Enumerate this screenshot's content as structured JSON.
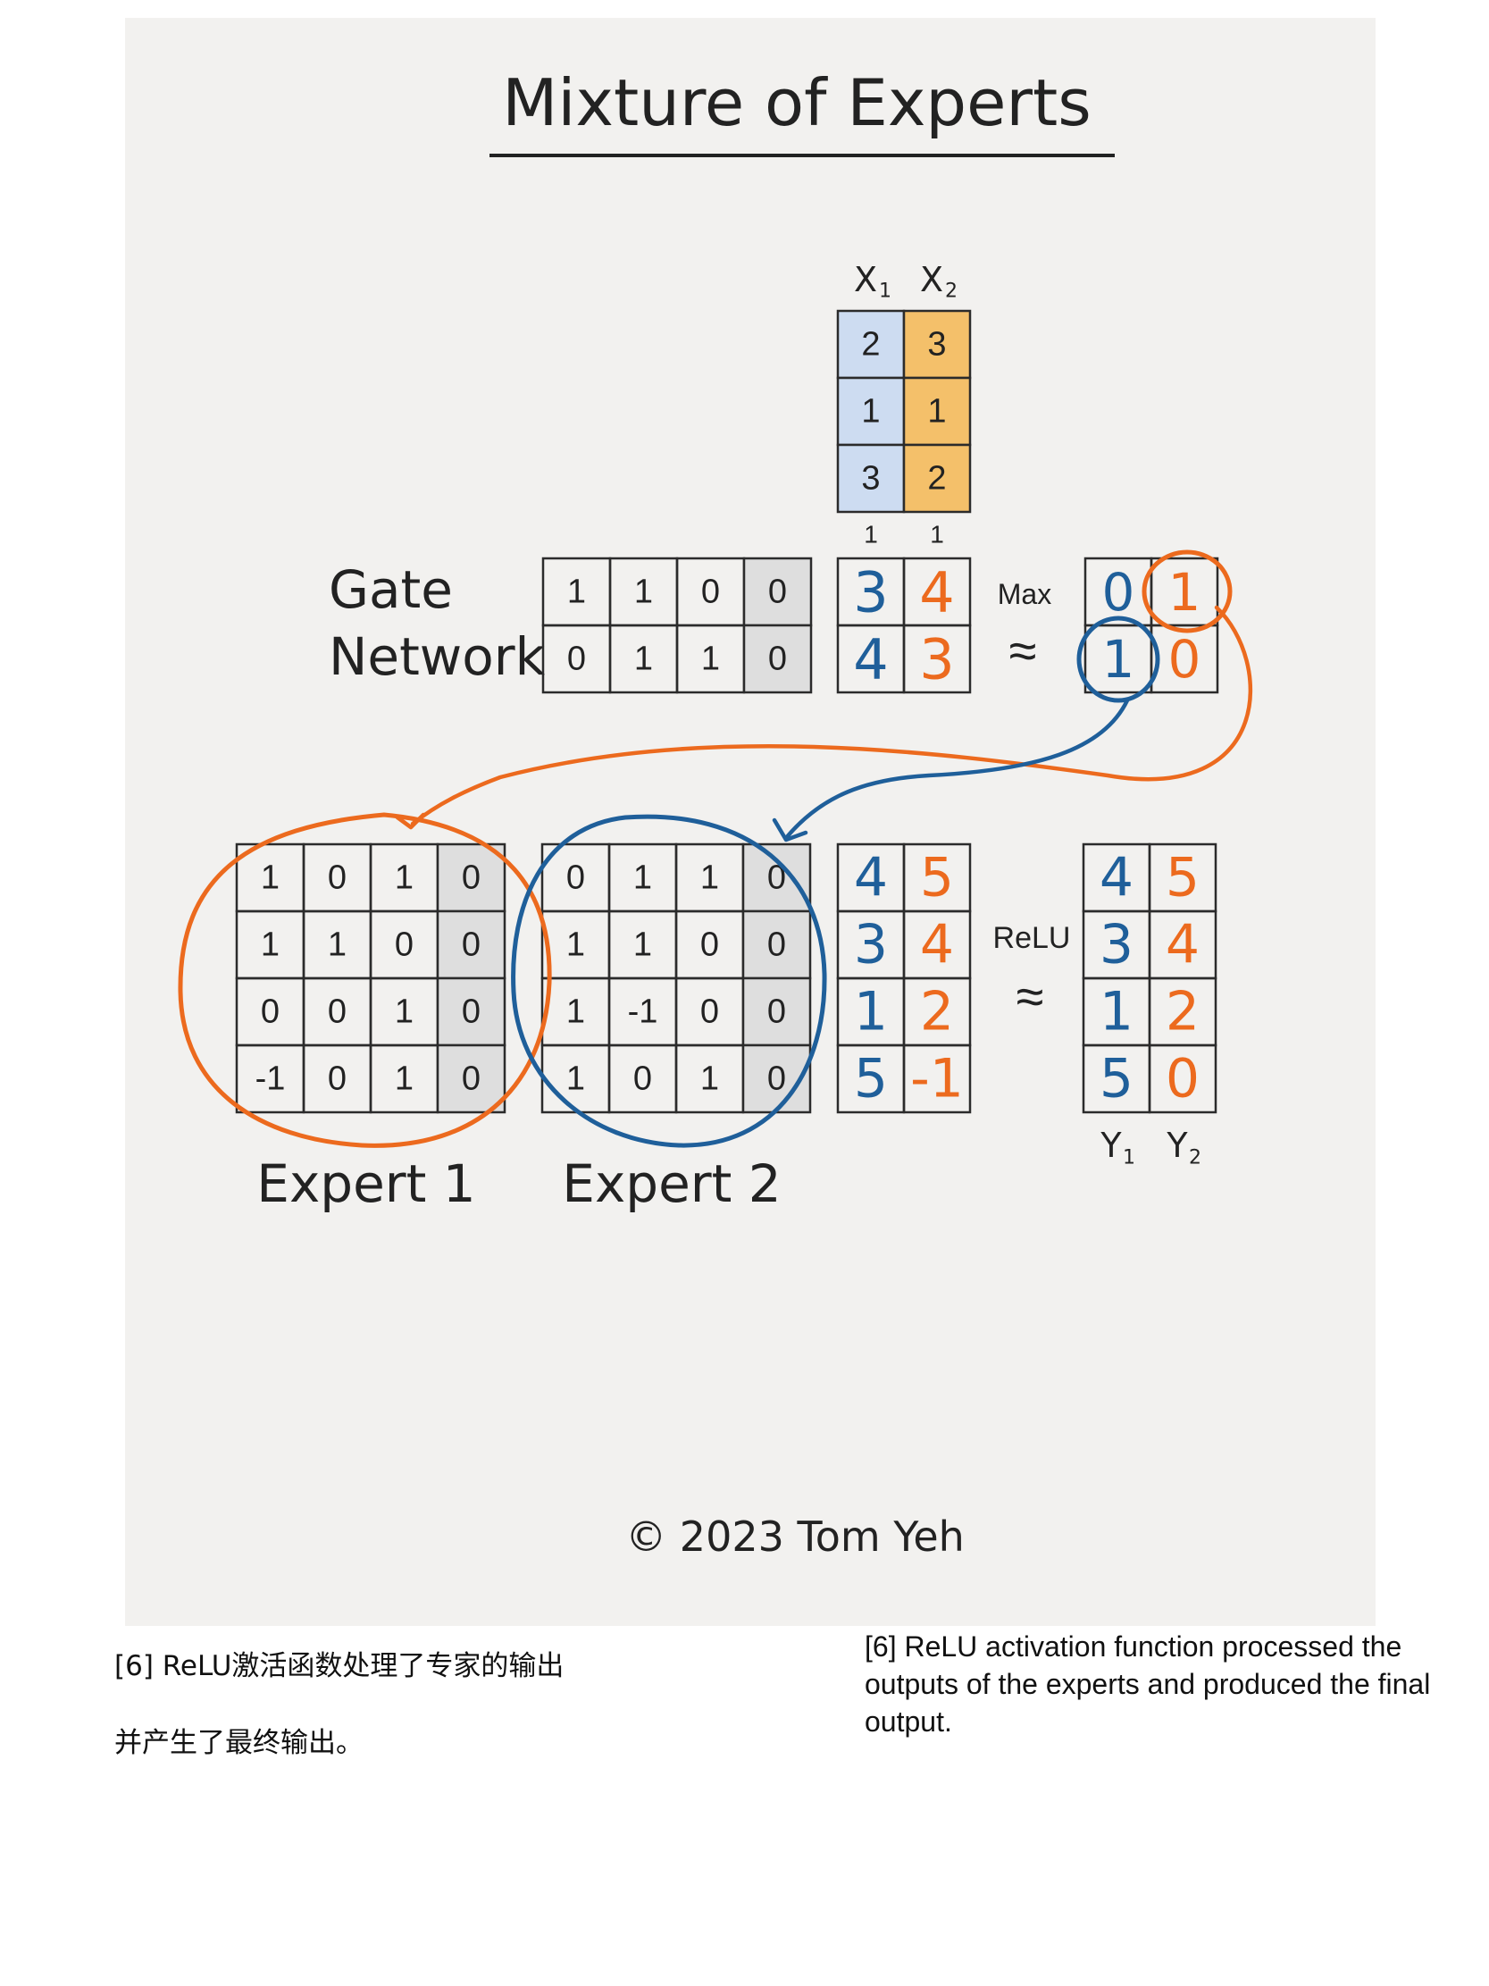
{
  "title": "Mixture of Experts",
  "input": {
    "headers": [
      "X",
      "X"
    ],
    "header_subscripts": [
      "1",
      "2"
    ],
    "rows": [
      [
        "2",
        "3"
      ],
      [
        "1",
        "1"
      ],
      [
        "3",
        "2"
      ]
    ],
    "bias": [
      "1",
      "1"
    ],
    "colors": [
      "#cddcf1",
      "#f4c06a"
    ]
  },
  "gate": {
    "label_lines": [
      "Gate",
      "Network"
    ],
    "matrix": [
      [
        "1",
        "1",
        "0",
        "0"
      ],
      [
        "0",
        "1",
        "1",
        "0"
      ]
    ],
    "scores": [
      [
        "3",
        "4"
      ],
      [
        "4",
        "3"
      ]
    ],
    "op_label": "Max",
    "approx": "≈",
    "output": [
      [
        "0",
        "1"
      ],
      [
        "1",
        "0"
      ]
    ]
  },
  "experts": [
    {
      "label": "Expert 1",
      "matrix": [
        [
          "1",
          "0",
          "1",
          "0"
        ],
        [
          "1",
          "1",
          "0",
          "0"
        ],
        [
          "0",
          "0",
          "1",
          "0"
        ],
        [
          "-1",
          "0",
          "1",
          "0"
        ]
      ]
    },
    {
      "label": "Expert 2",
      "matrix": [
        [
          "0",
          "1",
          "1",
          "0"
        ],
        [
          "1",
          "1",
          "0",
          "0"
        ],
        [
          "1",
          "-1",
          "0",
          "0"
        ],
        [
          "1",
          "0",
          "1",
          "0"
        ]
      ]
    }
  ],
  "expert_out": [
    [
      "4",
      "5"
    ],
    [
      "3",
      "4"
    ],
    [
      "1",
      "2"
    ],
    [
      "5",
      "-1"
    ]
  ],
  "relu": {
    "label": "ReLU",
    "approx": "≈"
  },
  "final": {
    "matrix": [
      [
        "4",
        "5"
      ],
      [
        "3",
        "4"
      ],
      [
        "1",
        "2"
      ],
      [
        "5",
        "0"
      ]
    ],
    "labels": [
      "Y",
      "Y"
    ],
    "label_subscripts": [
      "1",
      "2"
    ]
  },
  "copyright": "©  2023 Tom Yeh",
  "colors": {
    "blue": "#1f5f9a",
    "orange": "#ec6a1e",
    "grid": "#2b2b2b",
    "shade": "#dedede"
  },
  "captions": {
    "zh_line1": "[6] ReLU激活函数处理了专家的输出",
    "zh_line2": "并产生了最终输出。",
    "en": "[6] ReLU activation function processed the outputs of the experts and produced the final output."
  }
}
